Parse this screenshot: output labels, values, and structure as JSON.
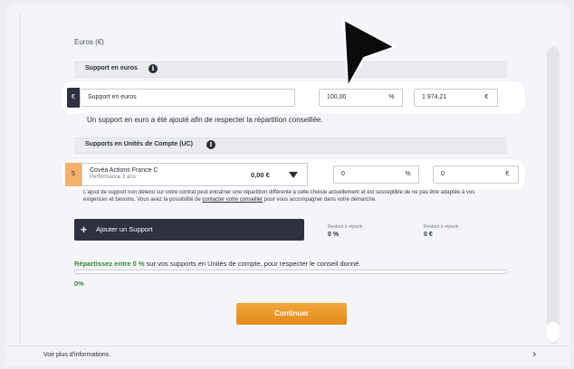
{
  "section": {
    "title": "Euros (€)"
  },
  "euro_support": {
    "band_label": "Support en euros",
    "badge": "€",
    "name_value": "Support en euros",
    "percent_value": "100,00",
    "percent_unit": "%",
    "amount_value": "1 974,21",
    "amount_unit": "€",
    "note": "Un support en euro a été ajouté afin de respecter la répartition conseillée."
  },
  "uc_support": {
    "band_label": "Supports en Unités de Compte (UC)",
    "index": "5",
    "fund_name": "Covéa Actions France C",
    "fund_perf": "Performance 3 ans:",
    "fund_amount": "0,00 €",
    "percent_value": "0",
    "percent_unit": "%",
    "amount_value": "0",
    "amount_unit": "€"
  },
  "warning": {
    "text": "L'ajout de support non détenu sur votre contrat peut entraîner une répartition différente à celle choisie actuellement et est susceptible de ne pas être adaptée à vos exigences et besoins. Vous avez la possibilité de ",
    "link": "contacter votre conseiller",
    "tail": " pour vous accompagner dans votre démarche."
  },
  "add_button": {
    "icon": "plus-icon",
    "label": "Ajouter un Support"
  },
  "remaining": [
    {
      "label": "Restant à répartir :",
      "value": "0 %"
    },
    {
      "label": "Restant à répartir :",
      "value": "0 €"
    }
  ],
  "repartition": {
    "prefix": "Répartissez entre 0 %",
    "suffix": " sur vos supports en Unités de compte, pour respecter le conseil donné.",
    "progress_pct": 0,
    "progress_label": "0%"
  },
  "continue_label": "Continuer",
  "footer": {
    "label": "Voir plus d'informations.",
    "chevron": "›"
  },
  "colors": {
    "accent": "#e38a1a",
    "dark": "#2e3240",
    "green": "#2f8a3c",
    "badge_orange": "#f7b06a"
  }
}
